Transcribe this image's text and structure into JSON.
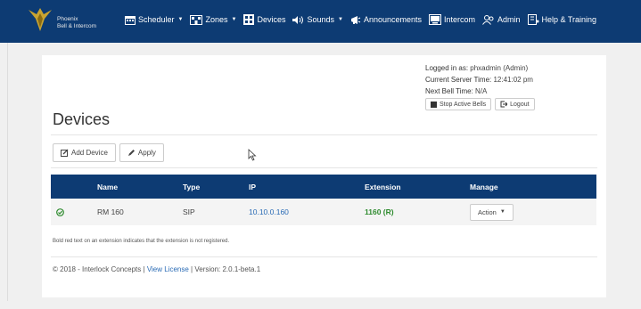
{
  "brand": {
    "line1": "Phoenix",
    "line2": "Bell & Intercom"
  },
  "nav": [
    {
      "label": "Scheduler",
      "icon": "calendar-icon",
      "dropdown": true
    },
    {
      "label": "Zones",
      "icon": "building-icon",
      "dropdown": true
    },
    {
      "label": "Devices",
      "icon": "devices-icon",
      "dropdown": false
    },
    {
      "label": "Sounds",
      "icon": "speaker-icon",
      "dropdown": true
    },
    {
      "label": "Announcements",
      "icon": "megaphone-icon",
      "dropdown": false
    },
    {
      "label": "Intercom",
      "icon": "intercom-icon",
      "dropdown": false
    },
    {
      "label": "Admin",
      "icon": "users-icon",
      "dropdown": false
    },
    {
      "label": "Help & Training",
      "icon": "help-icon",
      "dropdown": false
    }
  ],
  "session": {
    "logged_label": "Logged in as:",
    "logged_value": "phxadmin (Admin)",
    "time_label": "Current Server Time:",
    "time_value": "12:41:02 pm",
    "bell_label": "Next Bell Time:",
    "bell_value": "N/A",
    "stop_label": "Stop Active Bells",
    "logout_label": "Logout"
  },
  "page": {
    "title": "Devices"
  },
  "toolbar": {
    "add_label": "Add Device",
    "apply_label": "Apply"
  },
  "table": {
    "headers": [
      "Name",
      "Type",
      "IP",
      "Extension",
      "Manage"
    ],
    "rows": [
      {
        "status": "ok",
        "name": "RM 160",
        "type": "SIP",
        "ip": "10.10.0.160",
        "extension": "1160 (R)",
        "action": "Action"
      }
    ]
  },
  "note": "Bold red text on an extension indicates that the extension is not registered.",
  "footer": {
    "copyright": "© 2018 - Interlock Concepts |",
    "license": "View License",
    "version": "| Version: 2.0.1-beta.1"
  },
  "colors": {
    "navbar": "#0d3b73",
    "link": "#2a6bb5",
    "ok": "#2e8b2e"
  }
}
